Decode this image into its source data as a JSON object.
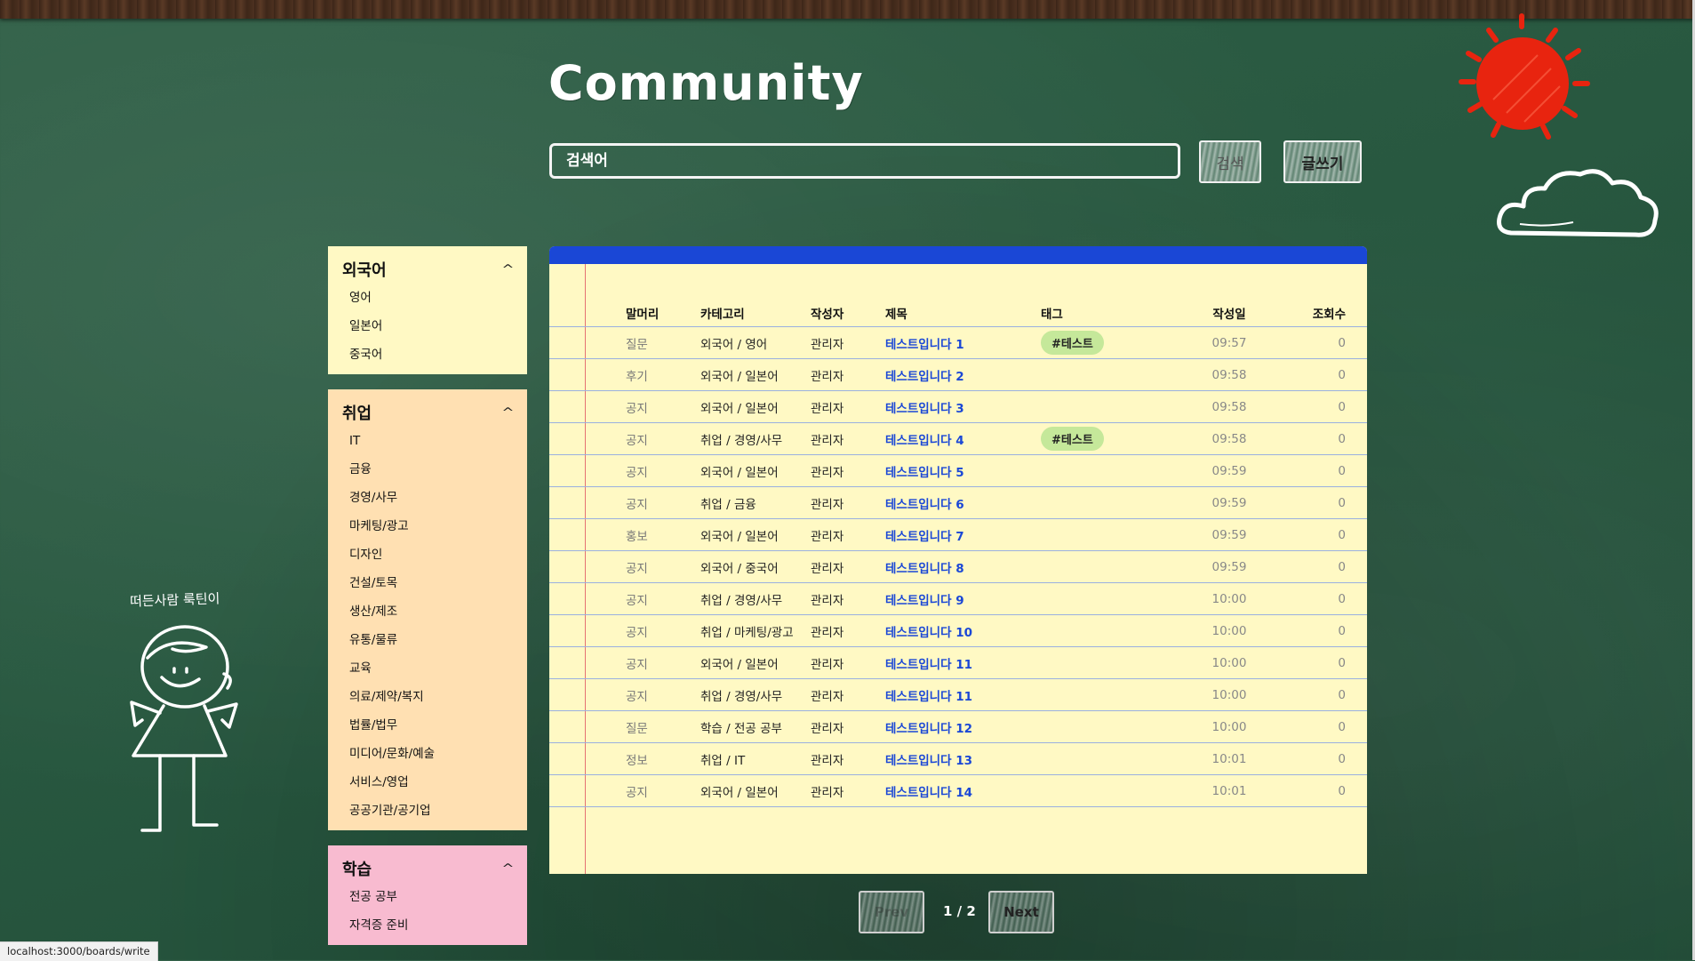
{
  "header": {
    "title": "Community",
    "search_placeholder": "검색어",
    "search_button": "검색",
    "write_button": "글쓰기"
  },
  "decoration": {
    "character_label": "떠든사람 룩틴이"
  },
  "sidebar": {
    "sections": [
      {
        "title": "외국어",
        "items": [
          "영어",
          "일본어",
          "중국어"
        ]
      },
      {
        "title": "취업",
        "items": [
          "IT",
          "금융",
          "경영/사무",
          "마케팅/광고",
          "디자인",
          "건설/토목",
          "생산/제조",
          "유통/물류",
          "교육",
          "의료/제약/복지",
          "법률/법무",
          "미디어/문화/예술",
          "서비스/영업",
          "공공기관/공기업"
        ]
      },
      {
        "title": "학습",
        "items": [
          "전공 공부",
          "자격증 준비"
        ]
      }
    ]
  },
  "table": {
    "columns": [
      "말머리",
      "카테고리",
      "작성자",
      "제목",
      "태그",
      "작성일",
      "조회수"
    ],
    "rows": [
      {
        "head": "질문",
        "category": "외국어 / 영어",
        "author": "관리자",
        "title": "테스트입니다 1",
        "tag": "#테스트",
        "date": "09:57",
        "views": "0"
      },
      {
        "head": "후기",
        "category": "외국어 / 일본어",
        "author": "관리자",
        "title": "테스트입니다 2",
        "tag": "",
        "date": "09:58",
        "views": "0"
      },
      {
        "head": "공지",
        "category": "외국어 / 일본어",
        "author": "관리자",
        "title": "테스트입니다 3",
        "tag": "",
        "date": "09:58",
        "views": "0"
      },
      {
        "head": "공지",
        "category": "취업 / 경영/사무",
        "author": "관리자",
        "title": "테스트입니다 4",
        "tag": "#테스트",
        "date": "09:58",
        "views": "0"
      },
      {
        "head": "공지",
        "category": "외국어 / 일본어",
        "author": "관리자",
        "title": "테스트입니다 5",
        "tag": "",
        "date": "09:59",
        "views": "0"
      },
      {
        "head": "공지",
        "category": "취업 / 금융",
        "author": "관리자",
        "title": "테스트입니다 6",
        "tag": "",
        "date": "09:59",
        "views": "0"
      },
      {
        "head": "홍보",
        "category": "외국어 / 일본어",
        "author": "관리자",
        "title": "테스트입니다 7",
        "tag": "",
        "date": "09:59",
        "views": "0"
      },
      {
        "head": "공지",
        "category": "외국어 / 중국어",
        "author": "관리자",
        "title": "테스트입니다 8",
        "tag": "",
        "date": "09:59",
        "views": "0"
      },
      {
        "head": "공지",
        "category": "취업 / 경영/사무",
        "author": "관리자",
        "title": "테스트입니다 9",
        "tag": "",
        "date": "10:00",
        "views": "0"
      },
      {
        "head": "공지",
        "category": "취업 / 마케팅/광고",
        "author": "관리자",
        "title": "테스트입니다 10",
        "tag": "",
        "date": "10:00",
        "views": "0"
      },
      {
        "head": "공지",
        "category": "외국어 / 일본어",
        "author": "관리자",
        "title": "테스트입니다 11",
        "tag": "",
        "date": "10:00",
        "views": "0"
      },
      {
        "head": "공지",
        "category": "취업 / 경영/사무",
        "author": "관리자",
        "title": "테스트입니다 11",
        "tag": "",
        "date": "10:00",
        "views": "0"
      },
      {
        "head": "질문",
        "category": "학습 / 전공 공부",
        "author": "관리자",
        "title": "테스트입니다 12",
        "tag": "",
        "date": "10:00",
        "views": "0"
      },
      {
        "head": "정보",
        "category": "취업 / IT",
        "author": "관리자",
        "title": "테스트입니다 13",
        "tag": "",
        "date": "10:01",
        "views": "0"
      },
      {
        "head": "공지",
        "category": "외국어 / 일본어",
        "author": "관리자",
        "title": "테스트입니다 14",
        "tag": "",
        "date": "10:01",
        "views": "0"
      }
    ]
  },
  "pagination": {
    "prev": "Prev",
    "indicator": "1 / 2",
    "next": "Next"
  },
  "status_bar": {
    "url": "localhost:3000/boards/write"
  },
  "colors": {
    "board_header": "#1a47d6",
    "title_link": "#1a47d6",
    "tag_bg": "#c5e89a",
    "note_yellow": "#fff9c4",
    "note_orange": "#ffe0b2",
    "note_pink": "#f8bbd0",
    "sun": "#e8240f"
  }
}
